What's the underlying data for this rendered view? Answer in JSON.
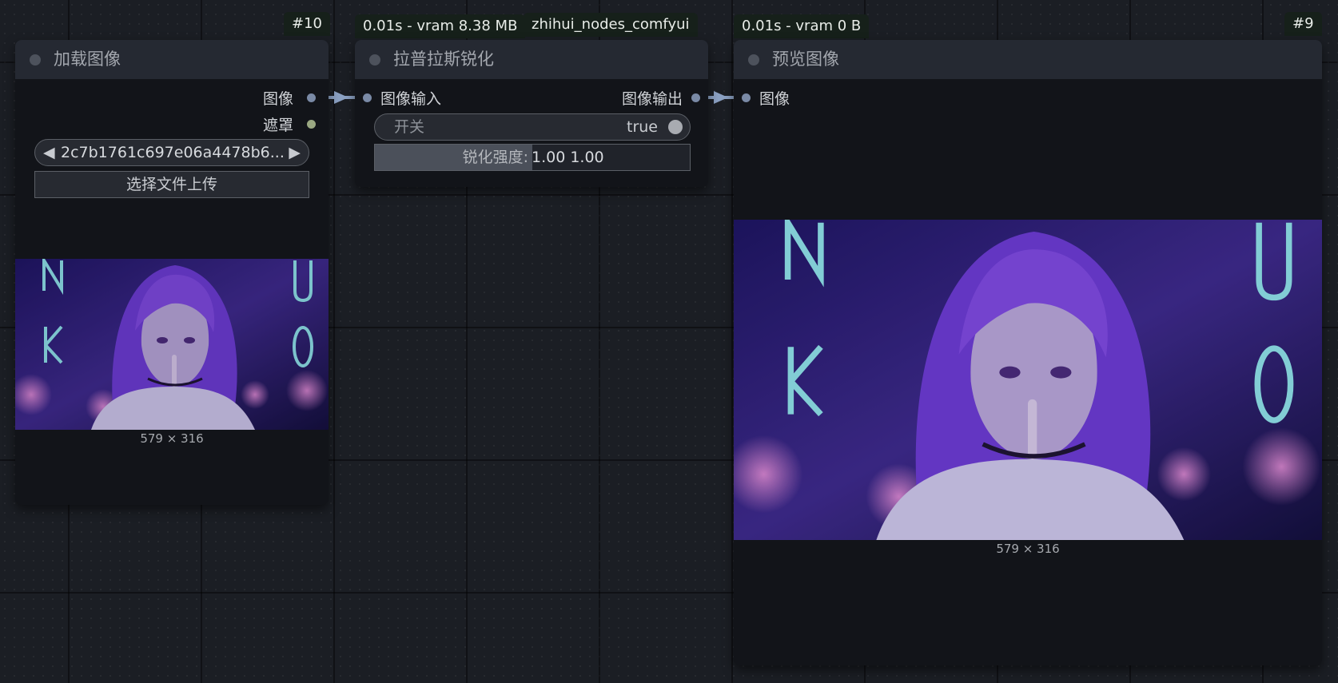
{
  "nodes": {
    "load_image": {
      "id_badge": "#10",
      "title": "加载图像",
      "outputs": {
        "image": "图像",
        "mask": "遮罩"
      },
      "file_combo": {
        "value": "2c7b1761c697e06a4478b6...",
        "left_arrow": "◀",
        "right_arrow": "▶"
      },
      "upload_button": "选择文件上传",
      "image_size": "579 × 316"
    },
    "sharpen": {
      "timing_badge": "0.01s - vram 8.38 MB",
      "source_badge": "zhihui_nodes_comfyui",
      "title": "拉普拉斯锐化",
      "input_label": "图像输入",
      "output_label": "图像输出",
      "toggle": {
        "label": "开关",
        "value": "true"
      },
      "strength": {
        "label": "锐化强度:",
        "value": "1.00  1.00",
        "fill_fraction": 0.5
      }
    },
    "preview": {
      "timing_badge": "0.01s - vram 0 B",
      "id_badge": "#9",
      "title": "预览图像",
      "input_label": "图像",
      "image_size": "579 × 316"
    }
  },
  "colors": {
    "canvas_bg": "#1b1e24",
    "node_body": "#121419",
    "node_header": "#252932",
    "image_slot": "#7a8aa6",
    "mask_slot": "#9aa882",
    "link": "#8ca2c4",
    "badge_bg": "#16201a"
  },
  "icons": {
    "node_status": "circle-dot-icon",
    "combo_left": "triangle-left-icon",
    "combo_right": "triangle-right-icon",
    "toggle_knob": "toggle-knob-icon",
    "link_arrow": "arrow-right-icon"
  },
  "images": {
    "content": "anime-girl-neon-city-thumbnail"
  }
}
